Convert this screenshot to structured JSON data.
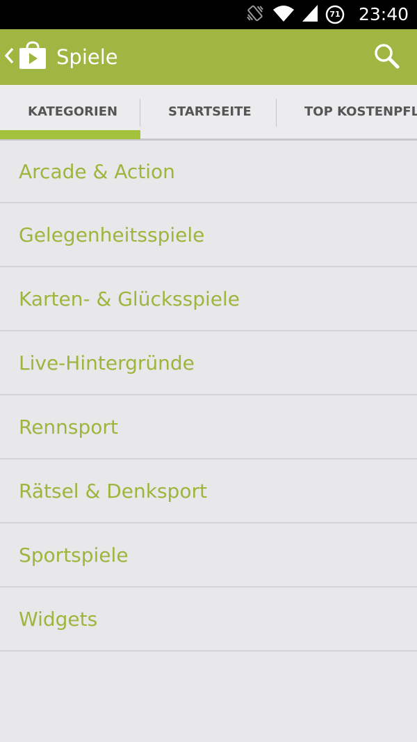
{
  "status_bar": {
    "time": "23:40",
    "icons": [
      "vibrate-icon",
      "wifi-icon",
      "signal-icon",
      "battery-71-icon"
    ],
    "battery_level": "71"
  },
  "action_bar": {
    "title": "Spiele",
    "color": "#a0b642",
    "icons": [
      "back-chevron-icon",
      "play-store-bag-icon",
      "search-icon"
    ]
  },
  "tabs": [
    {
      "label": "KATEGORIEN",
      "selected": true
    },
    {
      "label": "STARTSEITE",
      "selected": false
    },
    {
      "label": "TOP KOSTENPFLI",
      "selected": false
    }
  ],
  "categories": [
    "Arcade & Action",
    "Gelegenheitsspiele",
    "Karten- & Glücksspiele",
    "Live-Hintergründe",
    "Rennsport",
    "Rätsel & Denksport",
    "Sportspiele",
    "Widgets"
  ],
  "colors": {
    "accent": "#a4c23b",
    "list_text": "#9cb53d",
    "background": "#e8e8ea"
  }
}
